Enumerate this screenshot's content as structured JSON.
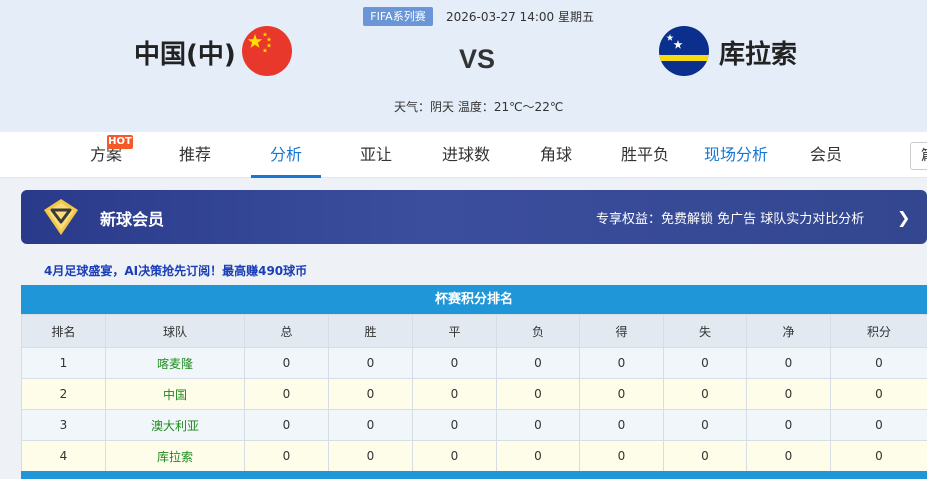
{
  "header": {
    "competition": "FIFA系列赛",
    "datetime": "2026-03-27 14:00 星期五",
    "home_team": "中国(中)",
    "away_team": "库拉索",
    "vs": "VS",
    "weather": "天气：阴天 温度：21℃～22℃"
  },
  "nav": {
    "items": [
      {
        "label": "方案"
      },
      {
        "label": "推荐"
      },
      {
        "label": "分析"
      },
      {
        "label": "亚让"
      },
      {
        "label": "进球数"
      },
      {
        "label": "角球"
      },
      {
        "label": "胜平负"
      },
      {
        "label": "现场分析"
      },
      {
        "label": "会员"
      }
    ],
    "hot_badge": "HOT",
    "active": "分析",
    "right_box": "篇"
  },
  "member": {
    "title": "新球会员",
    "desc": "专享权益：免费解锁 免广告 球队实力对比分析",
    "arrow": "❯"
  },
  "promo": "4月足球盛宴，AI决策抢先订阅！最高赚490球币",
  "standings": {
    "title": "杯赛积分排名",
    "headers": [
      "排名",
      "球队",
      "总",
      "胜",
      "平",
      "负",
      "得",
      "失",
      "净",
      "积分"
    ],
    "rows": [
      [
        "1",
        "喀麦隆",
        "0",
        "0",
        "0",
        "0",
        "0",
        "0",
        "0",
        "0"
      ],
      [
        "2",
        "中国",
        "0",
        "0",
        "0",
        "0",
        "0",
        "0",
        "0",
        "0"
      ],
      [
        "3",
        "澳大利亚",
        "0",
        "0",
        "0",
        "0",
        "0",
        "0",
        "0",
        "0"
      ],
      [
        "4",
        "库拉索",
        "0",
        "0",
        "0",
        "0",
        "0",
        "0",
        "0",
        "0"
      ]
    ]
  },
  "colors": {
    "accent": "#1677d2",
    "table_header": "#1e96d8",
    "team_green": "#1d8a1d",
    "member_bg": "#33468f"
  },
  "icons": {
    "home_flag": "china-flag-icon",
    "away_flag": "curacao-flag-icon",
    "member": "diamond-icon"
  }
}
